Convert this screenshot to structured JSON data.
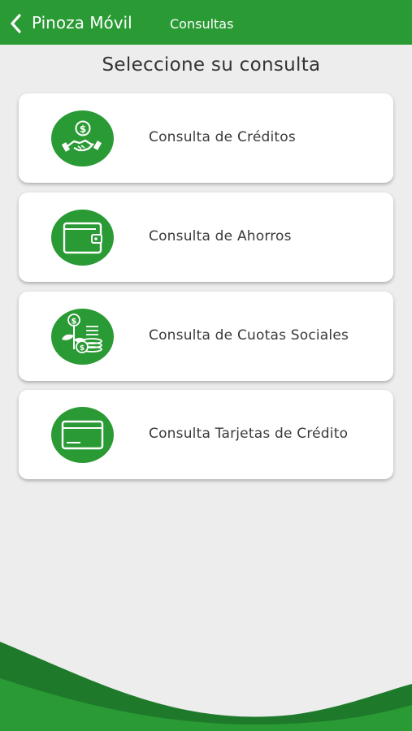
{
  "header": {
    "app_name": "Pinoza Móvil",
    "screen_title": "Consultas",
    "back_icon": "chevron-left-icon"
  },
  "main": {
    "heading": "Seleccione su consulta",
    "options": [
      {
        "label": "Consulta de Créditos",
        "icon": "credit-handshake-icon"
      },
      {
        "label": "Consulta de Ahorros",
        "icon": "wallet-icon"
      },
      {
        "label": "Consulta de Cuotas Sociales",
        "icon": "money-plant-coins-icon"
      },
      {
        "label": "Consulta Tarjetas de Crédito",
        "icon": "credit-card-icon"
      }
    ]
  },
  "colors": {
    "brand_green": "#2a9a35",
    "dark_green": "#1e7a2a",
    "background": "#ededed",
    "card": "#ffffff"
  }
}
